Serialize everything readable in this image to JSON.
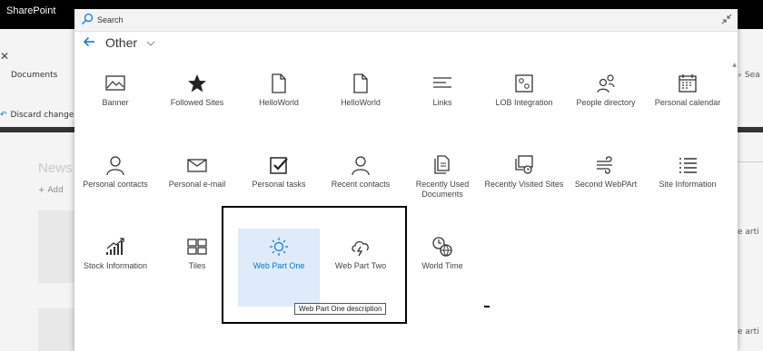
{
  "app": {
    "brand": "SharePoint"
  },
  "background": {
    "documents_label": "Documents",
    "discard_label": "Discard changes",
    "news_title": "News",
    "add_label": "+ Add",
    "right_texts": [
      "e arti",
      "e arti"
    ],
    "right_search_fragment": "Sea"
  },
  "toolbox": {
    "search": {
      "placeholder": "Search"
    },
    "category": "Other",
    "tiles": [
      {
        "label": "Banner",
        "icon": "banner-icon"
      },
      {
        "label": "Followed Sites",
        "icon": "star-icon"
      },
      {
        "label": "HelloWorld",
        "icon": "page-icon"
      },
      {
        "label": "HelloWorld",
        "icon": "page-icon"
      },
      {
        "label": "Links",
        "icon": "links-icon"
      },
      {
        "label": "LOB Integration",
        "icon": "lob-integration-icon"
      },
      {
        "label": "People directory",
        "icon": "people-directory-icon"
      },
      {
        "label": "Personal calendar",
        "icon": "calendar-icon"
      },
      {
        "label": "Personal contacts",
        "icon": "person-icon"
      },
      {
        "label": "Personal e-mail",
        "icon": "mail-icon"
      },
      {
        "label": "Personal tasks",
        "icon": "checkbox-icon"
      },
      {
        "label": "Recent contacts",
        "icon": "person-icon"
      },
      {
        "label": "Recently Used Documents",
        "icon": "documents-icon"
      },
      {
        "label": "Recently Visited Sites",
        "icon": "visited-sites-icon"
      },
      {
        "label": "Second WebPArt",
        "icon": "wind-icon"
      },
      {
        "label": "Site Information",
        "icon": "list-icon"
      },
      {
        "label": "Stock Information",
        "icon": "stock-chart-icon"
      },
      {
        "label": "Tiles",
        "icon": "tiles-icon"
      },
      {
        "label": "Web Part One",
        "icon": "sun-icon"
      },
      {
        "label": "Web Part Two",
        "icon": "storm-cloud-icon"
      },
      {
        "label": "World Time",
        "icon": "world-time-icon"
      }
    ],
    "selected_tile": "Web Part One",
    "tooltip": "Web Part One description"
  },
  "colors": {
    "accent": "#0078d4",
    "selected_bg": "#deecf9"
  }
}
